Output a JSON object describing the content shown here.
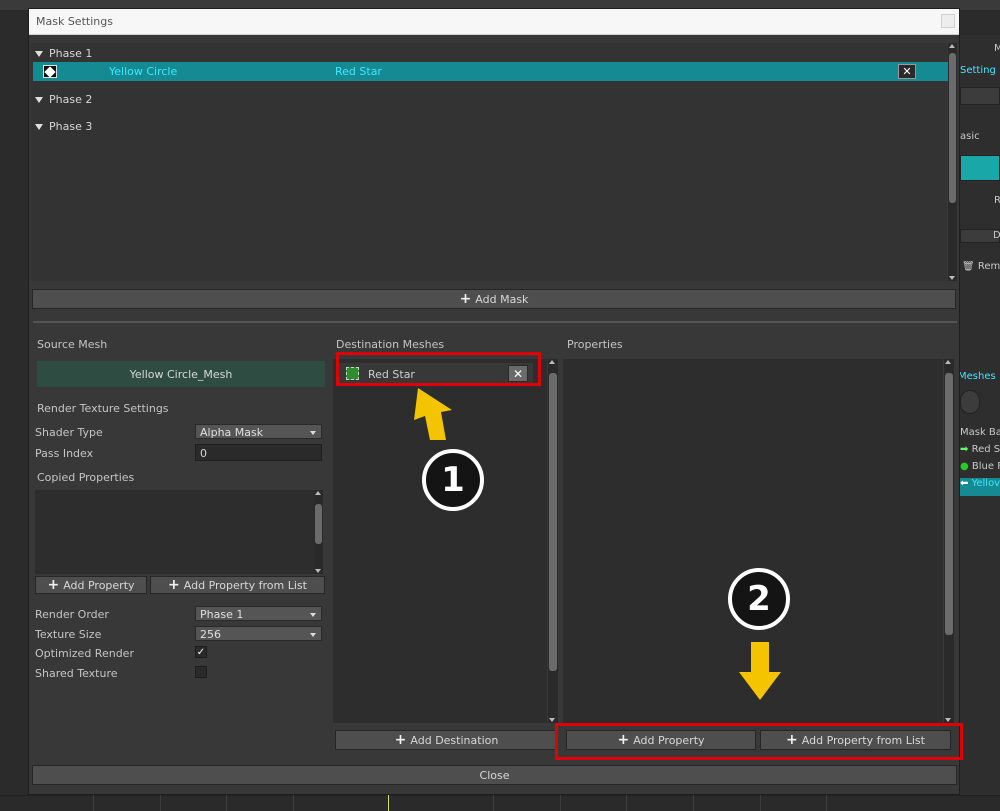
{
  "background": {
    "side_items": [
      "M",
      "Setting",
      "asic",
      "R",
      "D",
      "Rem",
      "Meshes",
      "Mask Ba",
      "Red S",
      "Blue F",
      "Yellov"
    ]
  },
  "window": {
    "title": "Mask Settings"
  },
  "phases": [
    {
      "label": "Phase 1"
    },
    {
      "label": "Phase 2"
    },
    {
      "label": "Phase 3"
    }
  ],
  "mask_row": {
    "source": "Yellow Circle",
    "destination": "Red Star",
    "close_glyph": "✕"
  },
  "add_mask_label": "Add Mask",
  "source_panel": {
    "heading": "Source Mesh",
    "mesh": "Yellow Circle_Mesh",
    "render_texture_heading": "Render Texture Settings",
    "shader_type_label": "Shader Type",
    "shader_type_value": "Alpha Mask",
    "pass_index_label": "Pass Index",
    "pass_index_value": "0",
    "copied_properties_heading": "Copied Properties",
    "add_property_label": "Add Property",
    "add_property_list_label": "Add Property from List",
    "render_order_label": "Render Order",
    "render_order_value": "Phase 1",
    "texture_size_label": "Texture Size",
    "texture_size_value": "256",
    "optimized_render_label": "Optimized Render",
    "optimized_render_checked": "✓",
    "shared_texture_label": "Shared Texture"
  },
  "destination_panel": {
    "heading": "Destination Meshes",
    "item_label": "Red Star",
    "item_close_glyph": "✕",
    "add_destination_label": "Add Destination"
  },
  "properties_panel": {
    "heading": "Properties",
    "add_property_label": "Add Property",
    "add_property_list_label": "Add Property from List"
  },
  "close_label": "Close",
  "annotations": {
    "step1": "1",
    "step2": "2",
    "highlight_color": "#e00000",
    "arrow_color": "#f5c400"
  }
}
